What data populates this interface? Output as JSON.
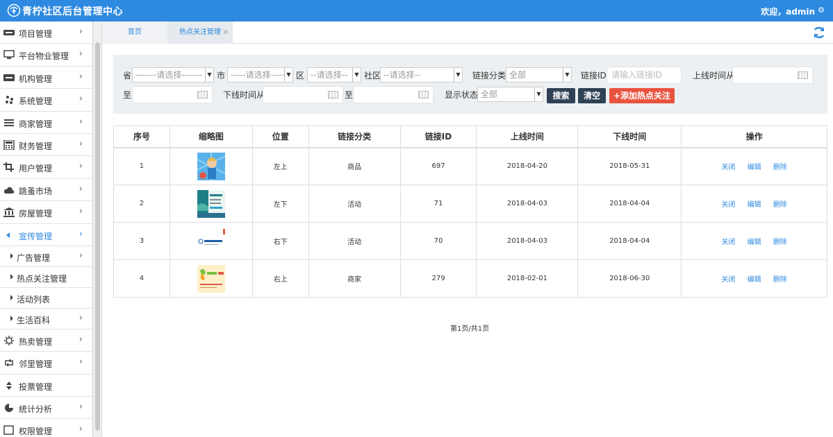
{
  "header": {
    "title": "青柠社区后台管理中心",
    "welcome": "欢迎，admin",
    "gear_icon": "gear-icon"
  },
  "sidebar": {
    "items": [
      {
        "label": "项目管理",
        "icon": "discover-card-icon"
      },
      {
        "label": "平台物业管理",
        "icon": "monitor-icon"
      },
      {
        "label": "机构管理",
        "icon": "stripe-icon"
      },
      {
        "label": "系统管理",
        "icon": "yelp-icon"
      },
      {
        "label": "商家管理",
        "icon": "list-icon"
      },
      {
        "label": "财务管理",
        "icon": "calculator-icon"
      },
      {
        "label": "用户管理",
        "icon": "crop-icon"
      },
      {
        "label": "跳蚤市场",
        "icon": "cloud-icon"
      },
      {
        "label": "房屋管理",
        "icon": "bank-icon"
      },
      {
        "label": "宣传管理",
        "icon": "caret-left-icon"
      }
    ],
    "sub_items": [
      {
        "label": "广告管理"
      },
      {
        "label": "热点关注管理"
      },
      {
        "label": "活动列表"
      },
      {
        "label": "生活百科"
      }
    ],
    "items_after": [
      {
        "label": "热卖管理",
        "icon": "sun-icon"
      },
      {
        "label": "邻里管理",
        "icon": "retweet-icon"
      },
      {
        "label": "投票管理",
        "icon": "sort-icon"
      },
      {
        "label": "统计分析",
        "icon": "pie-chart-icon"
      },
      {
        "label": "权限管理",
        "icon": "square-icon"
      }
    ]
  },
  "tabs": {
    "home": "首页",
    "hot": "热点关注管理",
    "close": "×"
  },
  "filter": {
    "province_label": "省",
    "province_value": "-------请选择-------",
    "city_label": "市",
    "city_value": "-----请选择-----",
    "district_label": "区",
    "district_value": "--请选择--",
    "community_label": "社区",
    "community_value": "--请选择--",
    "link_type_label": "链接分类:",
    "link_type_value": "全部",
    "link_id_label": "链接ID:",
    "link_id_placeholder": "请输入链接ID",
    "online_from_label": "上线时间从",
    "to_label_1": "至",
    "offline_from_label": "下线时间从",
    "to_label_2": "至",
    "status_label": "显示状态:",
    "status_value": "全部",
    "search_btn": "搜索",
    "clear_btn": "清空",
    "add_btn": "+添加热点关注"
  },
  "table": {
    "headers": [
      "序号",
      "缩略图",
      "位置",
      "链接分类",
      "链接ID",
      "上线时间",
      "下线时间",
      "操作"
    ],
    "rows": [
      {
        "no": "1",
        "position": "左上",
        "category": "商品",
        "link_id": "697",
        "online": "2018-04-20",
        "offline": "2018-05-31"
      },
      {
        "no": "2",
        "position": "左下",
        "category": "活动",
        "link_id": "71",
        "online": "2018-04-03",
        "offline": "2018-04-04"
      },
      {
        "no": "3",
        "position": "右下",
        "category": "活动",
        "link_id": "70",
        "online": "2018-04-03",
        "offline": "2018-04-04"
      },
      {
        "no": "4",
        "position": "右上",
        "category": "商家",
        "link_id": "279",
        "online": "2018-02-01",
        "offline": "2018-06-30"
      }
    ],
    "ops": {
      "close": "关闭",
      "edit": "编辑",
      "delete": "删除"
    }
  },
  "pager": "第1页/共1页",
  "colors": {
    "primary": "#2e8ae0",
    "dark_btn": "#2f4155",
    "red_btn": "#e8533f",
    "filter_bg": "#edf0f2"
  }
}
